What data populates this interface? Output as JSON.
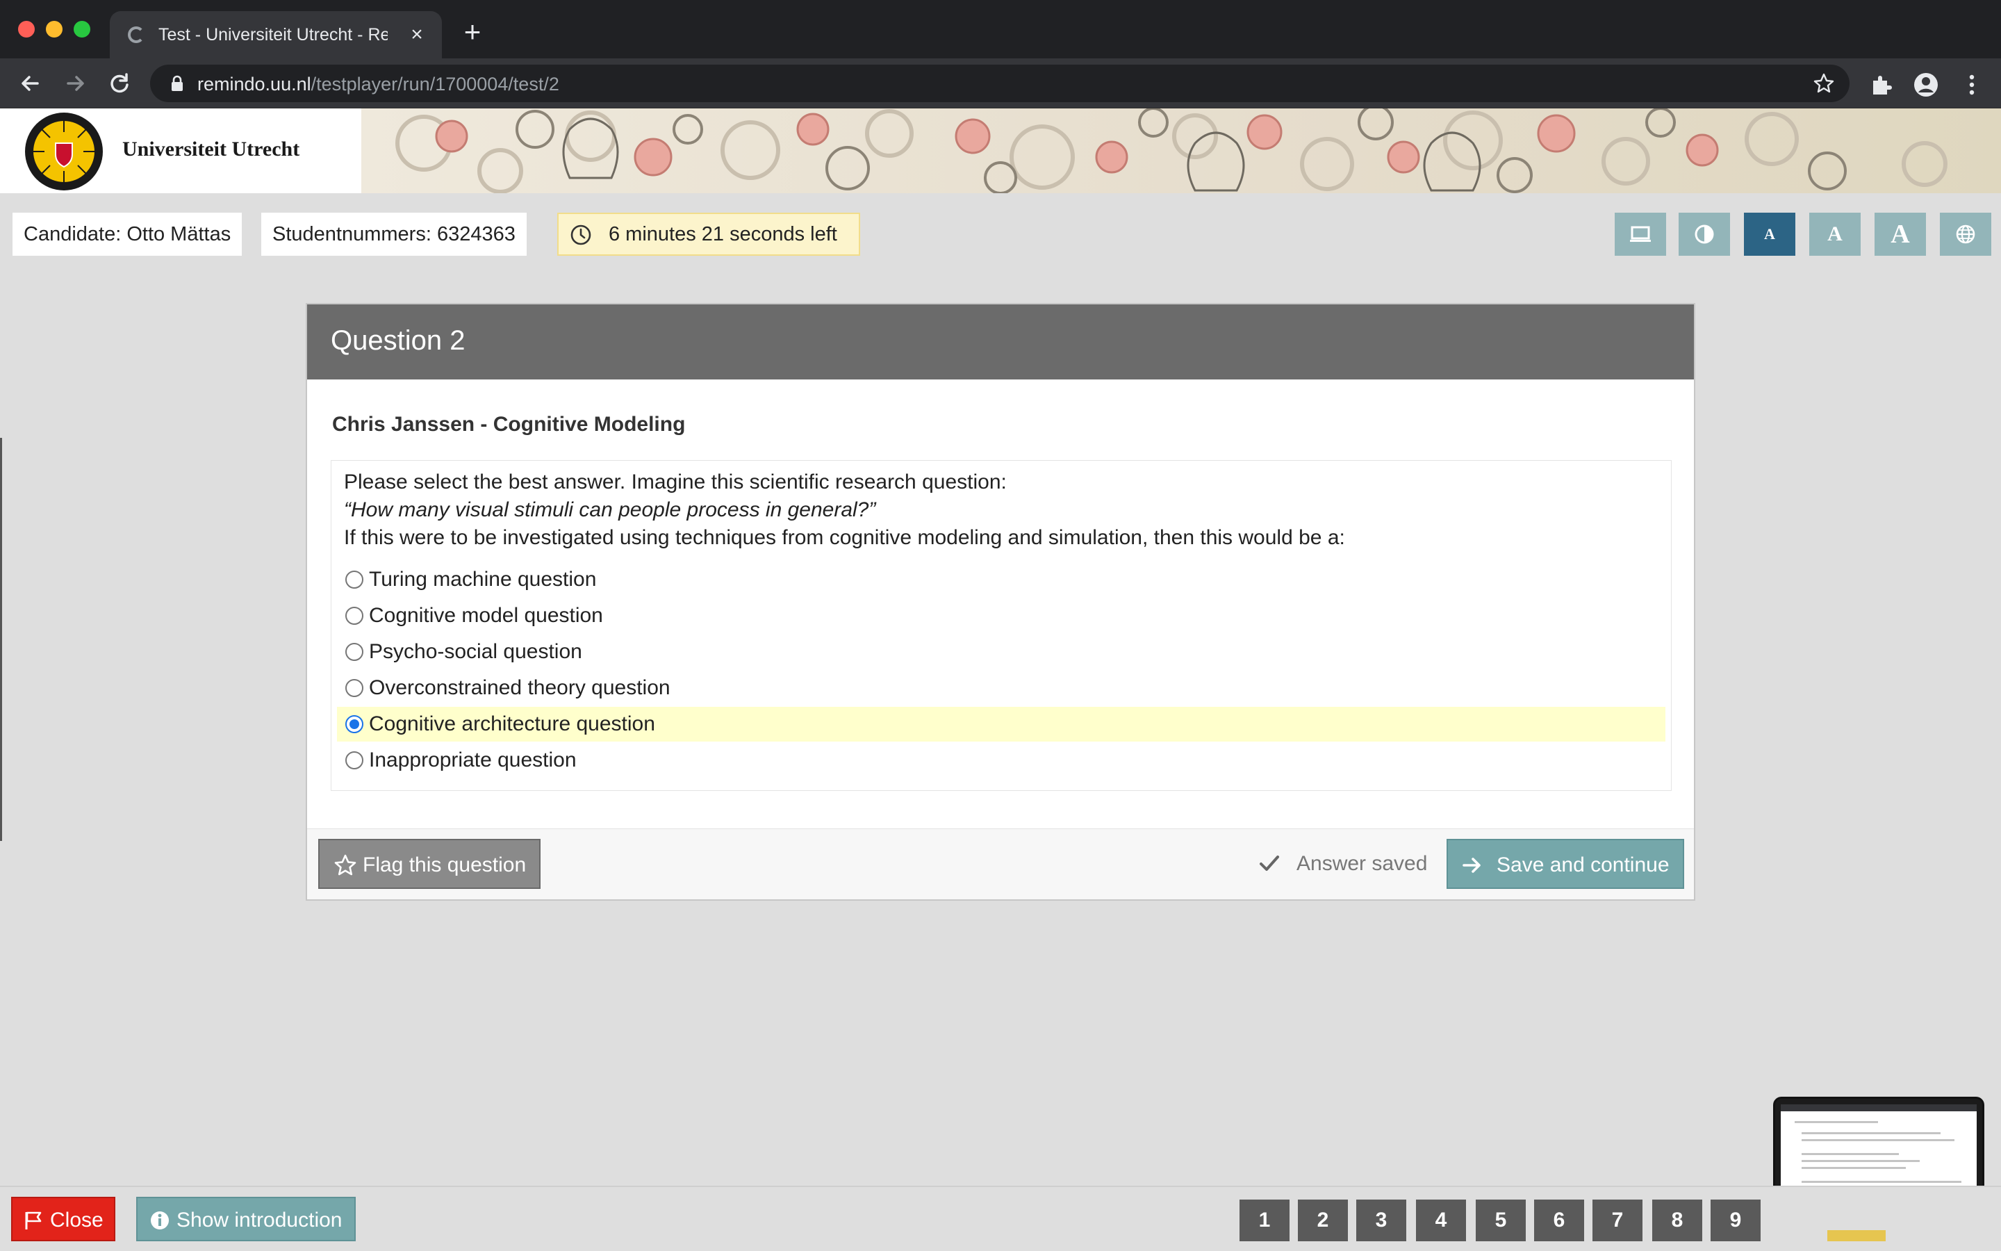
{
  "browser": {
    "tab_title": "Test - Universiteit Utrecht - Re",
    "url_host": "remindo.uu.nl",
    "url_path": "/testplayer/run/1700004/test/2"
  },
  "site": {
    "logo_text": "Universiteit Utrecht"
  },
  "infobar": {
    "candidate": "Candidate: Otto Mättas",
    "student_number": "Studentnummers: 6324363",
    "timer": "6 minutes 21 seconds left",
    "tools": [
      {
        "name": "screen-icon"
      },
      {
        "name": "contrast-icon"
      },
      {
        "label": "A",
        "name": "font-size-small",
        "active": true
      },
      {
        "label": "A",
        "name": "font-size-medium"
      },
      {
        "label": "A",
        "name": "font-size-large"
      },
      {
        "name": "globe-icon"
      }
    ]
  },
  "question": {
    "title": "Question 2",
    "subject": "Chris Janssen - Cognitive Modeling",
    "prompt_line1": "Please select the best answer. Imagine this scientific research question:",
    "prompt_line2": "“How many visual stimuli can people process in general?”",
    "prompt_line3": "If this were to be investigated using techniques from cognitive modeling and simulation, then this would be a:",
    "options": [
      {
        "label": "Turing machine question",
        "selected": false
      },
      {
        "label": "Cognitive model question",
        "selected": false
      },
      {
        "label": "Psycho-social question",
        "selected": false
      },
      {
        "label": "Overconstrained theory question",
        "selected": false
      },
      {
        "label": "Cognitive architecture question",
        "selected": true
      },
      {
        "label": "Inappropriate question",
        "selected": false
      }
    ],
    "flag_label": "Flag this question",
    "saved_label": "Answer saved",
    "save_continue_label": "Save and continue"
  },
  "bottombar": {
    "close_label": "Close",
    "intro_label": "Show introduction",
    "pages": [
      "1",
      "2",
      "3",
      "4",
      "5",
      "6",
      "7",
      "8",
      "9"
    ],
    "current_page": "2"
  },
  "colors": {
    "accent_teal": "#75a7aa",
    "active_tool": "#2c6485",
    "close_red": "#e2231a",
    "selected_highlight": "#ffffcc",
    "timer_bg": "#fcf4cc"
  }
}
